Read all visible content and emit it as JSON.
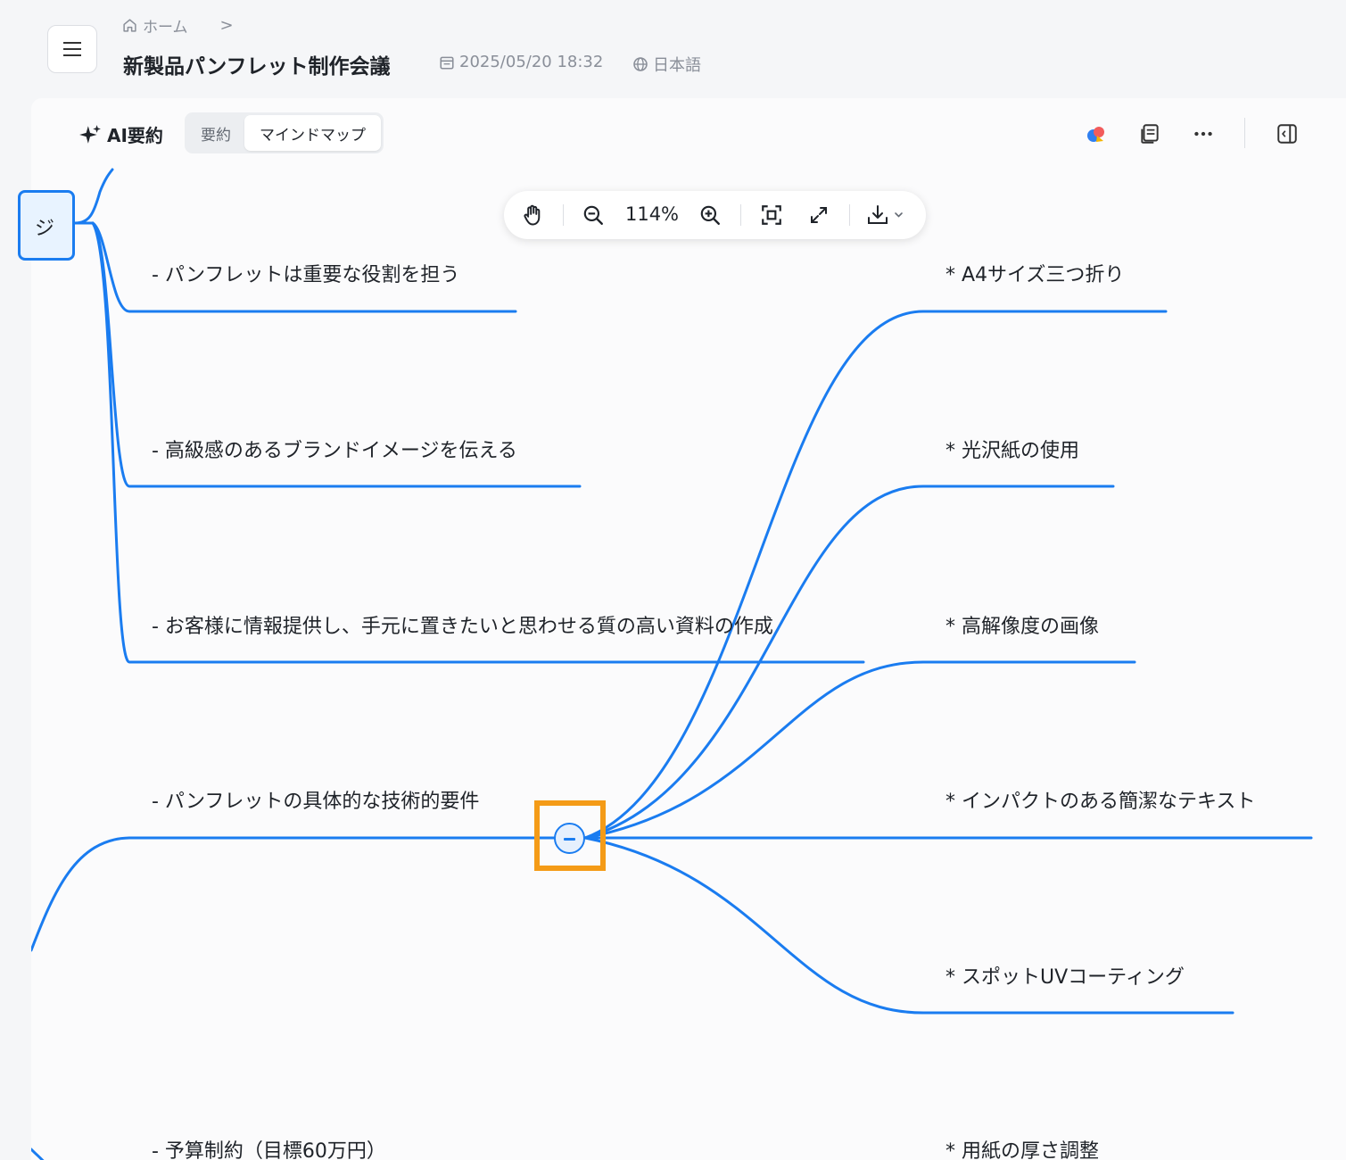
{
  "header": {
    "breadcrumb_home": "ホーム",
    "breadcrumb_sep": ">",
    "title": "新製品パンフレット制作会議",
    "date": "2025/05/20 18:32",
    "language": "日本語"
  },
  "panel": {
    "ai_label": "AI要約",
    "tabs": [
      "要約",
      "マインドマップ"
    ],
    "active_tab": "マインドマップ"
  },
  "toolbar": {
    "zoom": "114%"
  },
  "mindmap": {
    "root_label": "ジ",
    "left_nodes": [
      "- パンフレットは重要な役割を担う",
      "- 高級感のあるブランドイメージを伝える",
      "- お客様に情報提供し、手元に置きたいと思わせる質の高い資料の作成",
      "- パンフレットの具体的な技術的要件",
      "- 予算制約（目標60万円）"
    ],
    "right_nodes": [
      "* A4サイズ三つ折り",
      "* 光沢紙の使用",
      "* 高解像度の画像",
      "* インパクトのある簡潔なテキスト",
      "* スポットUVコーティング",
      "* 用紙の厚さ調整"
    ]
  },
  "colors": {
    "accent": "#1a7cf0",
    "highlight": "#f49b17",
    "node_fill": "#e8f3ff"
  }
}
